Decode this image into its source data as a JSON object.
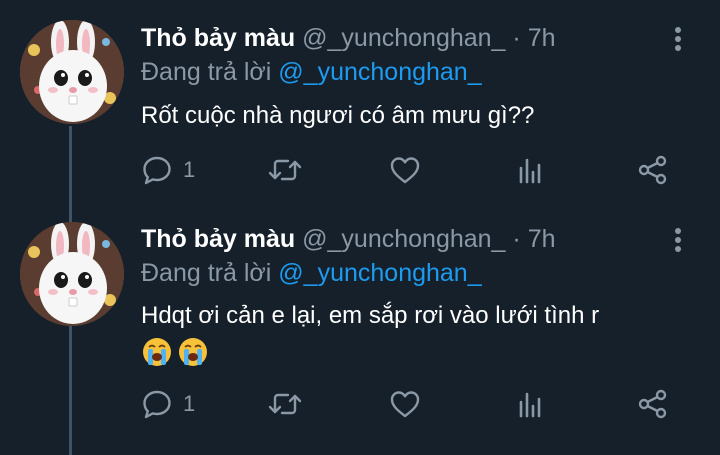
{
  "tweets": [
    {
      "name": "Thỏ bảy màu",
      "handle": "@_yunchonghan_",
      "separator": "·",
      "time": "7h",
      "reply_prefix": "Đang trả lời",
      "reply_to": "@_yunchonghan_",
      "text": "Rốt cuộc nhà ngươi có âm mưu gì??",
      "emojis": [],
      "reply_count": "1"
    },
    {
      "name": "Thỏ bảy màu",
      "handle": "@_yunchonghan_",
      "separator": "·",
      "time": "7h",
      "reply_prefix": "Đang trả lời",
      "reply_to": "@_yunchonghan_",
      "text": "Hdqt ơi cản e lại, em sắp rơi vào lưới tình r",
      "emojis": [
        "crying-face-emoji",
        "crying-face-emoji"
      ],
      "reply_count": "1"
    }
  ],
  "icons": {
    "reply": "reply-icon",
    "retweet": "retweet-icon",
    "like": "heart-icon",
    "analytics": "analytics-icon",
    "share": "share-icon",
    "more": "more-vertical-icon"
  },
  "colors": {
    "background": "#15202b",
    "text_primary": "#ffffff",
    "text_secondary": "#8b98a5",
    "mention": "#1d9bf0",
    "thread_line": "#3d5466"
  }
}
